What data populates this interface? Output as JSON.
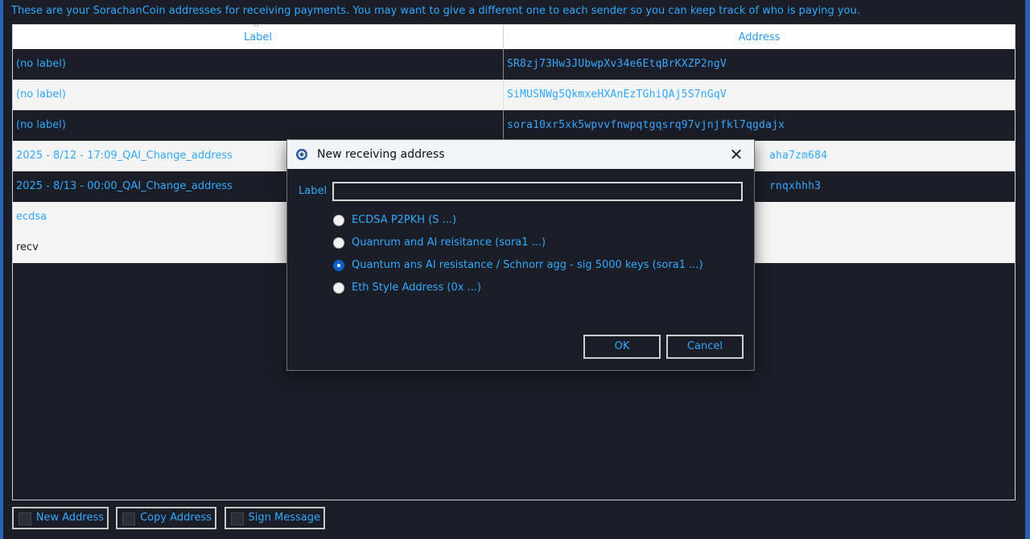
{
  "intro_text": "These are your SorachanCoin addresses for receiving payments. You may want to give a different one to each sender so you can keep track of who is paying you.",
  "table": {
    "columns": {
      "label": "Label",
      "address": "Address"
    },
    "rows": [
      {
        "label": "(no label)",
        "address": "SR8zj73Hw3JUbwpXv34e6EtqBrKXZP2ngV"
      },
      {
        "label": "(no label)",
        "address": "SiMUSNWg5QkmxeHXAnEzTGhiQAj5S7nGqV"
      },
      {
        "label": "(no label)",
        "address": "sora10xr5xk5wpvvfnwpqtgqsrq97vjnjfkl7qgdajx"
      },
      {
        "label": "2025 - 8/12 - 17:09_QAI_Change_address",
        "address": "aha7zm684"
      },
      {
        "label": "2025 - 8/13 - 00:00_QAI_Change_address",
        "address": "rnqxhhh3"
      },
      {
        "label": "ecdsa",
        "address": ""
      },
      {
        "label": "recv",
        "address": ""
      }
    ]
  },
  "buttons": {
    "new_address": "New Address",
    "copy_address": "Copy Address",
    "sign_message": "Sign Message"
  },
  "dialog": {
    "title": "New receiving address",
    "icon": "app-coin-icon",
    "label_caption": "Label",
    "label_value": "",
    "options": [
      {
        "text": "ECDSA P2PKH (S ...)",
        "selected": false
      },
      {
        "text": "Quanrum and AI reisitance (sora1 ...)",
        "selected": false
      },
      {
        "text": "Quantum ans AI resistance / Schnorr agg - sig 5000 keys (sora1 ...)",
        "selected": true
      },
      {
        "text": "Eth Style Address (0x ...)",
        "selected": false
      }
    ],
    "ok_label": "OK",
    "cancel_label": "Cancel",
    "close_glyph": "✕"
  },
  "colors": {
    "background": "#1b1e27",
    "accent_text": "#32a9ff",
    "selected_radio": "#0a63c9"
  }
}
